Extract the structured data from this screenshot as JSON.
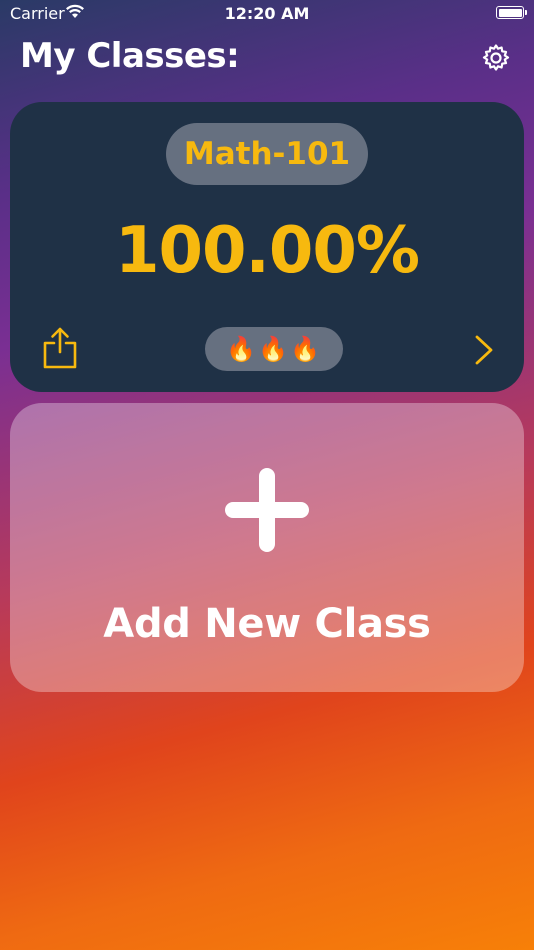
{
  "status_bar": {
    "carrier": "Carrier",
    "time": "12:20 AM"
  },
  "header": {
    "title": "My Classes:",
    "settings_icon": "gear-icon"
  },
  "classes": [
    {
      "name": "Math-101",
      "grade": "100.00%",
      "streak": "🔥🔥🔥",
      "share_icon": "share-icon",
      "open_icon": "chevron-right-icon"
    }
  ],
  "add_class": {
    "label": "Add New Class",
    "icon": "plus-icon"
  },
  "colors": {
    "accent": "#f7b90f",
    "card": "#1f3146"
  }
}
